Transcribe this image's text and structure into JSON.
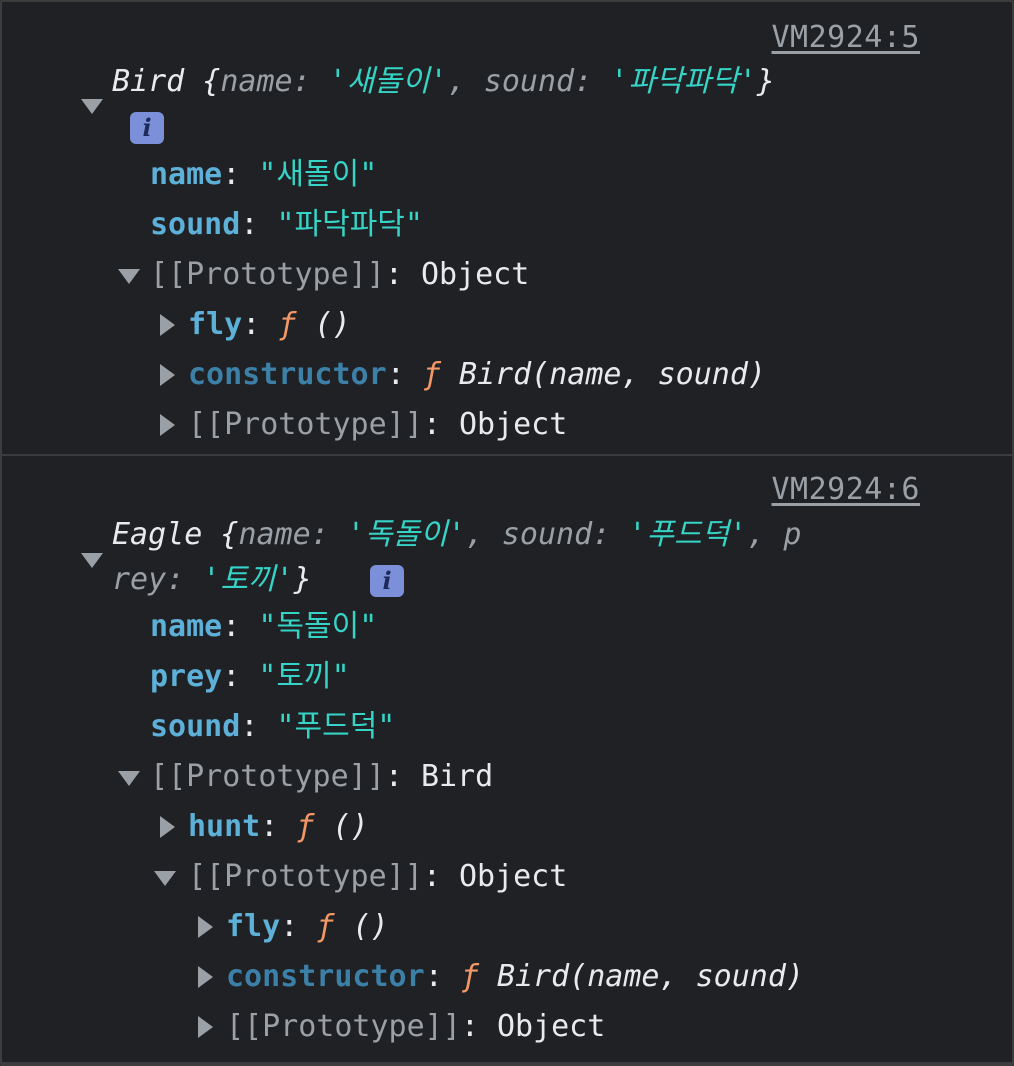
{
  "colors": {
    "background": "#202124",
    "property_key": "#5db0d7",
    "string_value": "#35d4c7",
    "function_marker": "#f29766",
    "info_badge": "#7c8fd9"
  },
  "entries": [
    {
      "source": "VM2924:5",
      "summary": {
        "class_name": "Bird",
        "open": " {",
        "k1": "name",
        "v1": "'새돌이'",
        "k2": "sound",
        "v2": "'파닥파닥'",
        "close": "}"
      },
      "info_badge": "i",
      "properties": [
        {
          "key": "name",
          "value": "\"새돌이\""
        },
        {
          "key": "sound",
          "value": "\"파닥파닥\""
        }
      ],
      "prototype": {
        "label": "[[Prototype]]",
        "type": "Object",
        "children": [
          {
            "key": "fly",
            "fn": "ƒ",
            "signature": "()"
          },
          {
            "key": "constructor",
            "fn": "ƒ",
            "signature": "Bird(name, sound)"
          },
          {
            "key": "[[Prototype]]",
            "type": "Object"
          }
        ]
      }
    },
    {
      "source": "VM2924:6",
      "summary": {
        "class_name": "Eagle",
        "open": " {",
        "k1": "name",
        "v1": "'독돌이'",
        "k2": "sound",
        "v2": "'푸드덕'",
        "k3_start": "p",
        "k3_end": "rey",
        "v3": "'토끼'",
        "close": "}"
      },
      "info_badge": "i",
      "properties": [
        {
          "key": "name",
          "value": "\"독돌이\""
        },
        {
          "key": "prey",
          "value": "\"토끼\""
        },
        {
          "key": "sound",
          "value": "\"푸드덕\""
        }
      ],
      "prototype": {
        "label": "[[Prototype]]",
        "type": "Bird",
        "children": [
          {
            "key": "hunt",
            "fn": "ƒ",
            "signature": "()"
          }
        ],
        "nested": {
          "label": "[[Prototype]]",
          "type": "Object",
          "children": [
            {
              "key": "fly",
              "fn": "ƒ",
              "signature": "()"
            },
            {
              "key": "constructor",
              "fn": "ƒ",
              "signature": "Bird(name, sound)"
            },
            {
              "key": "[[Prototype]]",
              "type": "Object"
            }
          ]
        }
      }
    }
  ]
}
